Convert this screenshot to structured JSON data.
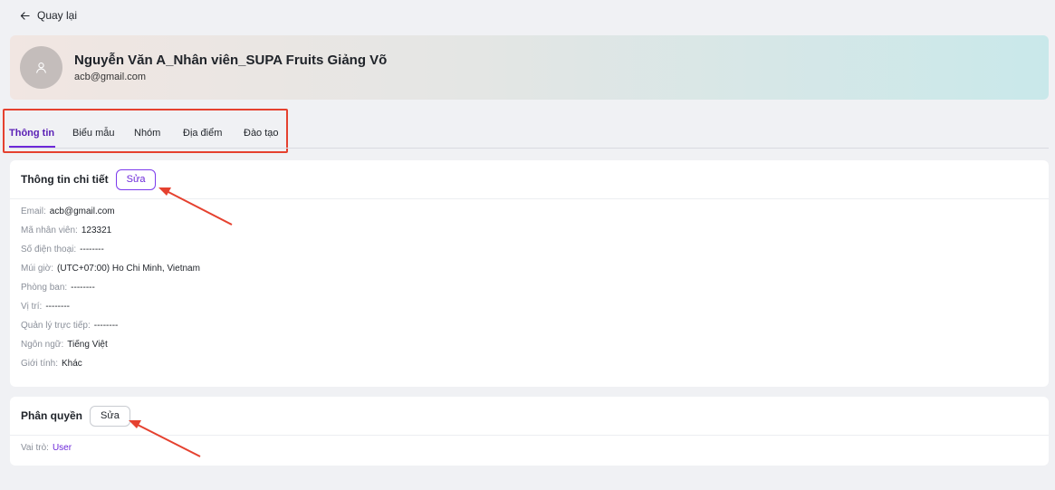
{
  "back_label": "Quay lại",
  "profile": {
    "name": "Nguyễn Văn A_Nhân viên_SUPA Fruits Giảng Võ",
    "email": "acb@gmail.com"
  },
  "tabs": [
    {
      "label": "Thông tin",
      "active": true
    },
    {
      "label": "Biểu mẫu",
      "active": false
    },
    {
      "label": "Nhóm",
      "active": false
    },
    {
      "label": "Địa điểm",
      "active": false
    },
    {
      "label": "Đào tạo",
      "active": false
    }
  ],
  "details": {
    "title": "Thông tin chi tiết",
    "edit_label": "Sửa",
    "fields": [
      {
        "label": "Email:",
        "value": "acb@gmail.com"
      },
      {
        "label": "Mã nhân viên:",
        "value": "123321"
      },
      {
        "label": "Số điện thoại:",
        "value": "--------"
      },
      {
        "label": "Múi giờ:",
        "value": "(UTC+07:00) Ho Chi Minh, Vietnam"
      },
      {
        "label": "Phòng ban:",
        "value": "--------"
      },
      {
        "label": "Vị trí:",
        "value": "--------"
      },
      {
        "label": "Quản lý trực tiếp:",
        "value": "--------"
      },
      {
        "label": "Ngôn ngữ:",
        "value": "Tiếng Việt"
      },
      {
        "label": "Giới tính:",
        "value": "Khác"
      }
    ]
  },
  "permissions": {
    "title": "Phân quyền",
    "edit_label": "Sửa",
    "role_label": "Vai trò:",
    "role_value": "User"
  },
  "colors": {
    "accent": "#6d28d9",
    "annotation": "#e5412f"
  },
  "icons": {
    "back": "arrow-left-icon",
    "avatar": "user-icon"
  }
}
